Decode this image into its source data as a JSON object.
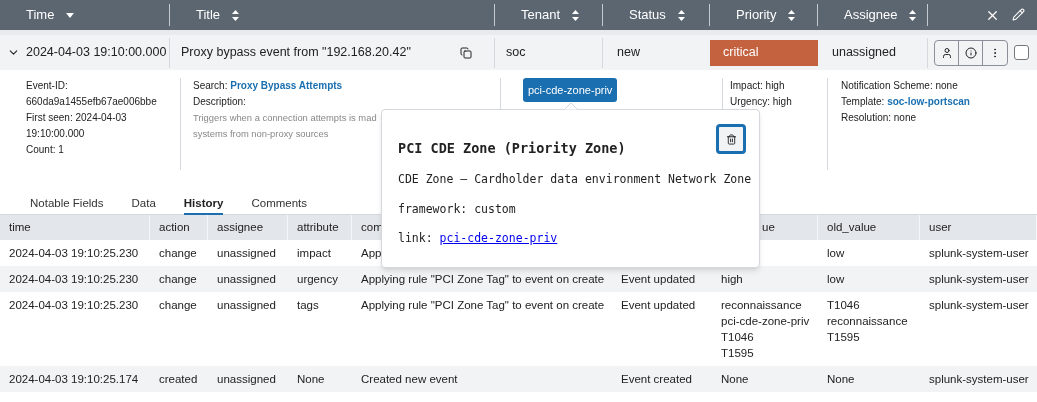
{
  "header": {
    "columns": [
      {
        "label": "Time",
        "sorted": true
      },
      {
        "label": "Title",
        "sorted": false
      },
      {
        "label": "Tenant",
        "sorted": false
      },
      {
        "label": "Status",
        "sorted": false
      },
      {
        "label": "Priority",
        "sorted": false
      },
      {
        "label": "Assignee",
        "sorted": false
      }
    ]
  },
  "event": {
    "expanded": true,
    "time": "2024-04-03 19:10:00.000",
    "title": "Proxy bypass event from \"192.168.20.42\"",
    "tenant": "soc",
    "status": "new",
    "priority": {
      "label": "critical",
      "color": "#c4613f"
    },
    "assignee": "unassigned",
    "checked": false,
    "details": {
      "event_id": "Event-ID: 660da9a1455efb67ae006bbe",
      "first_seen": "First seen: 2024-04-03 19:10:00.000",
      "count": "Count: 1",
      "search_label": "Search: ",
      "search_link": "Proxy Bypass Attempts",
      "description_label": "Description:",
      "description": "Triggers when a connection attempts is mad",
      "description_2": "systems from non-proxy sources",
      "tag": "pci-cde-zone-priv",
      "impact": "Impact: high",
      "urgency": "Urgency: high",
      "notification": "Notification Scheme: none",
      "template_label": "Template: ",
      "template_link": "soc-low-portscan",
      "resolution": "Resolution: none"
    }
  },
  "tabs": [
    {
      "label": "Notable Fields",
      "selected": false
    },
    {
      "label": "Data",
      "selected": false
    },
    {
      "label": "History",
      "selected": true
    },
    {
      "label": "Comments",
      "selected": false
    }
  ],
  "history": {
    "columns": [
      "time",
      "action",
      "assignee",
      "attribute",
      "com",
      null,
      "ue",
      "old_value",
      "user"
    ],
    "rows": [
      {
        "time": "2024-04-03 19:10:25.230",
        "action": "change",
        "assignee": "unassigned",
        "attribute": "impact",
        "comment": "App",
        "old_value": "low",
        "user": "splunk-system-user"
      },
      {
        "time": "2024-04-03 19:10:25.230",
        "action": "change",
        "assignee": "unassigned",
        "attribute": "urgency",
        "comment": "Applying rule \"PCI Zone Tag\" to event on create",
        "status": "Event updated",
        "new_value": [
          "high"
        ],
        "old_value": "low",
        "user": "splunk-system-user"
      },
      {
        "time": "2024-04-03 19:10:25.230",
        "action": "change",
        "assignee": "unassigned",
        "attribute": "tags",
        "comment": "Applying rule \"PCI Zone Tag\" to event on create",
        "status": "Event updated",
        "new_value": [
          "reconnaissance",
          "pci-cde-zone-priv",
          "T1046",
          "T1595"
        ],
        "old_value": "T1046\nreconnaissance\nT1595",
        "user": "splunk-system-user"
      },
      {
        "time": "2024-04-03 19:10:25.174",
        "action": "created",
        "assignee": "unassigned",
        "attribute": "None",
        "comment": "Created new event",
        "status": "Event created",
        "new_value": [
          "None"
        ],
        "old_value": "None",
        "user": "splunk-system-user"
      }
    ]
  },
  "popover": {
    "title": "PCI CDE Zone (Priority Zone)",
    "description": "CDE Zone – Cardholder data environment Network Zone",
    "framework": "framework: custom",
    "link_label": "link: ",
    "link": "pci-cde-zone-priv"
  }
}
